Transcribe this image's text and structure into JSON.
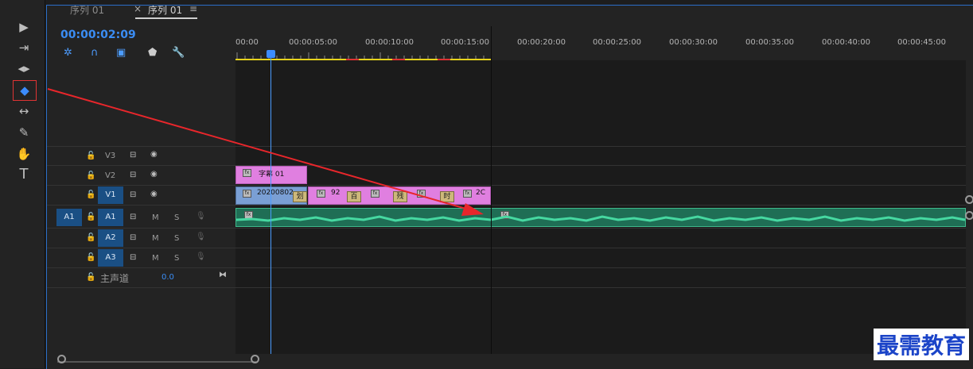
{
  "tabs": [
    {
      "label": "序列 01"
    },
    {
      "label": "序列 01"
    }
  ],
  "tab_close": "×",
  "tab_menu": "≡",
  "timecode": "00:00:02:09",
  "ruler": [
    "00:00",
    "00:00:05:00",
    "00:00:10:00",
    "00:00:15:00",
    "00:00:20:00",
    "00:00:25:00",
    "00:00:30:00",
    "00:00:35:00",
    "00:00:40:00",
    "00:00:45:00"
  ],
  "tracks": {
    "v3": "V3",
    "v2": "V2",
    "v1": "V1",
    "a1_src": "A1",
    "a1": "A1",
    "a2": "A2",
    "a3": "A3",
    "m": "M",
    "s": "S",
    "master": "主声道",
    "master_value": "0.0"
  },
  "clips": {
    "title": "字幕 01",
    "v1_a": "20200802",
    "v1_b": "92",
    "v1_c": "2C",
    "tag1": "划",
    "tag2": "百",
    "tag3": "残",
    "tag4": "时"
  },
  "watermark": "最需教育",
  "colors": {
    "accent": "#3b8df4",
    "title_clip": "#e07fe0",
    "video_clip": "#7a9fd4",
    "audio_clip": "#1f6e55",
    "annotation": "#e8262b"
  }
}
